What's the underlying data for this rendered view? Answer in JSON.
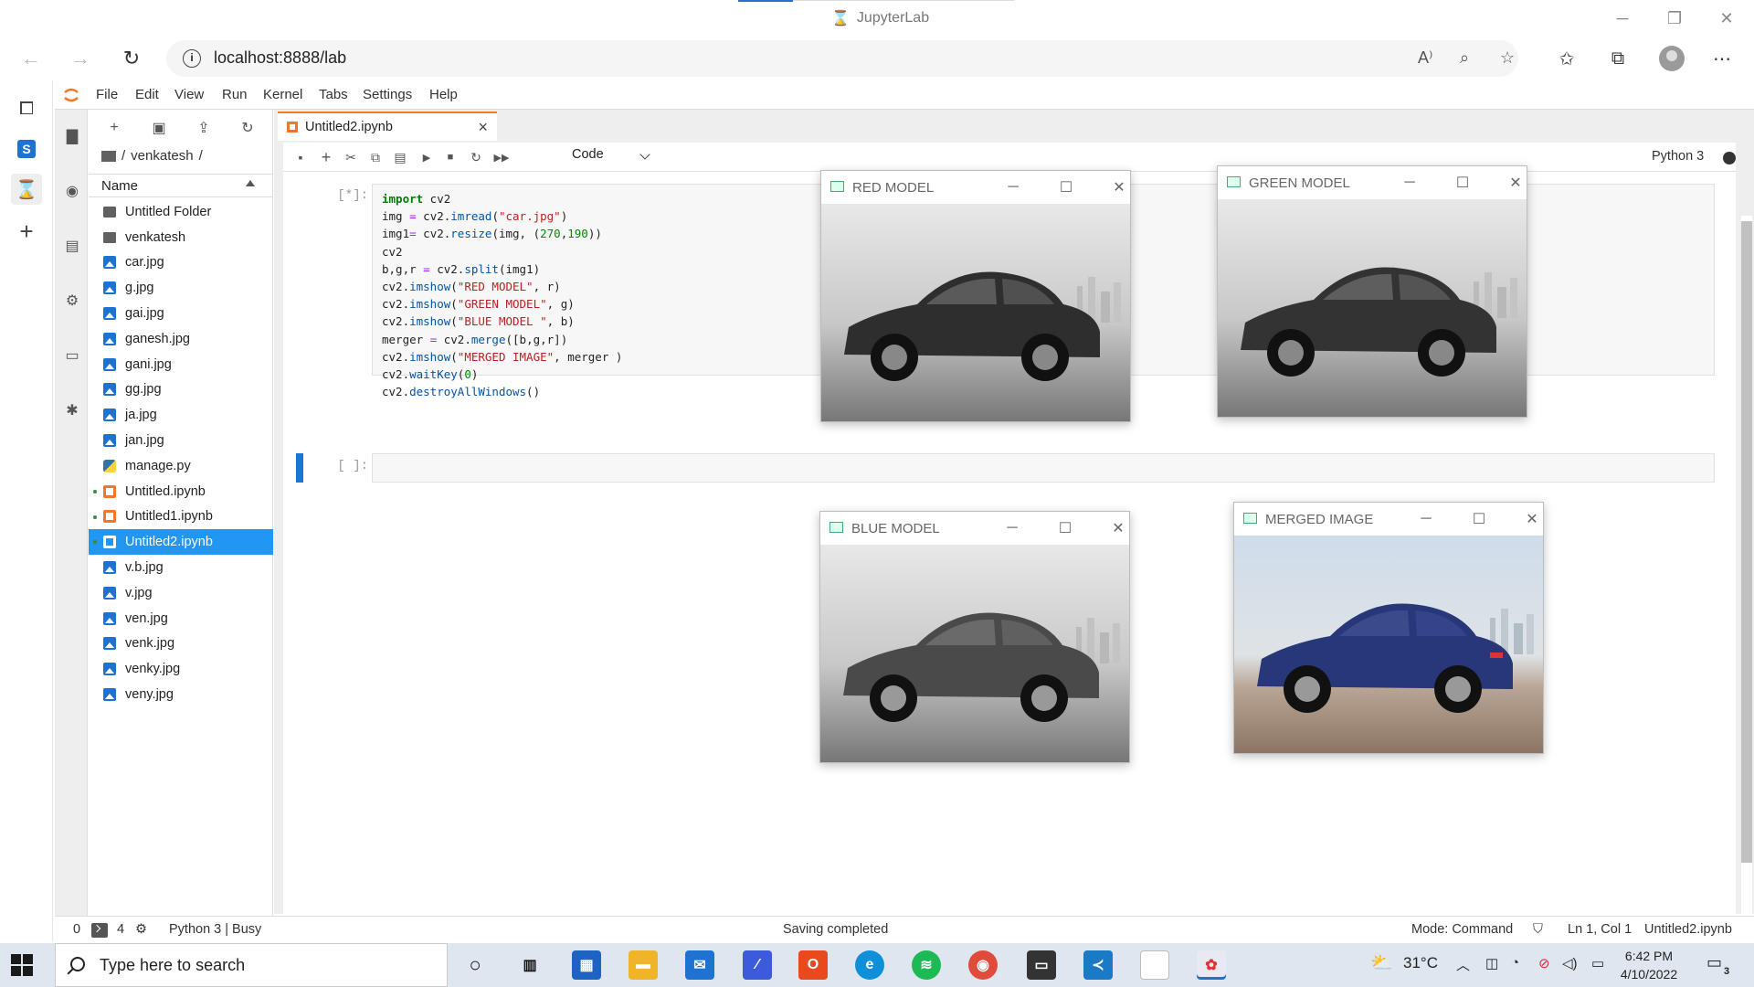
{
  "browser": {
    "window_title": "JupyterLab",
    "url": "localhost:8888/lab"
  },
  "jupyter": {
    "menu": [
      "File",
      "Edit",
      "View",
      "Run",
      "Kernel",
      "Tabs",
      "Settings",
      "Help"
    ],
    "breadcrumb": [
      "/",
      "venkatesh",
      "/"
    ],
    "file_header": "Name",
    "files": [
      {
        "name": "Untitled Folder",
        "type": "folder",
        "running": false,
        "selected": false
      },
      {
        "name": "venkatesh",
        "type": "folder",
        "running": false,
        "selected": false
      },
      {
        "name": "car.jpg",
        "type": "image",
        "running": false,
        "selected": false
      },
      {
        "name": "g.jpg",
        "type": "image",
        "running": false,
        "selected": false
      },
      {
        "name": "gai.jpg",
        "type": "image",
        "running": false,
        "selected": false
      },
      {
        "name": "ganesh.jpg",
        "type": "image",
        "running": false,
        "selected": false
      },
      {
        "name": "gani.jpg",
        "type": "image",
        "running": false,
        "selected": false
      },
      {
        "name": "gg.jpg",
        "type": "image",
        "running": false,
        "selected": false
      },
      {
        "name": "ja.jpg",
        "type": "image",
        "running": false,
        "selected": false
      },
      {
        "name": "jan.jpg",
        "type": "image",
        "running": false,
        "selected": false
      },
      {
        "name": "manage.py",
        "type": "python",
        "running": false,
        "selected": false
      },
      {
        "name": "Untitled.ipynb",
        "type": "notebook",
        "running": true,
        "selected": false
      },
      {
        "name": "Untitled1.ipynb",
        "type": "notebook",
        "running": true,
        "selected": false
      },
      {
        "name": "Untitled2.ipynb",
        "type": "notebook",
        "running": true,
        "selected": true
      },
      {
        "name": "v.b.jpg",
        "type": "image",
        "running": false,
        "selected": false
      },
      {
        "name": "v.jpg",
        "type": "image",
        "running": false,
        "selected": false
      },
      {
        "name": "ven.jpg",
        "type": "image",
        "running": false,
        "selected": false
      },
      {
        "name": "venk.jpg",
        "type": "image",
        "running": false,
        "selected": false
      },
      {
        "name": "venky.jpg",
        "type": "image",
        "running": false,
        "selected": false
      },
      {
        "name": "veny.jpg",
        "type": "image",
        "running": false,
        "selected": false
      }
    ],
    "tab_title": "Untitled2.ipynb",
    "cell_type": "Code",
    "kernel_name": "Python 3",
    "cells": [
      {
        "prompt": "[*]:",
        "code": "import cv2\nimg = cv2.imread(\"car.jpg\")\nimg1= cv2.resize(img, (270,190))\ncv2\nb,g,r = cv2.split(img1)\ncv2.imshow(\"RED MODEL\", r)\ncv2.imshow(\"GREEN MODEL\", g)\ncv2.imshow(\"BLUE MODEL \", b)\nmerger = cv2.merge([b,g,r])\ncv2.imshow(\"MERGED IMAGE\", merger )\ncv2.waitKey(0)\ncv2.destroyAllWindows()"
      },
      {
        "prompt": "[ ]:",
        "code": ""
      }
    ]
  },
  "cv_windows": [
    {
      "title": "RED MODEL",
      "tint": "gray"
    },
    {
      "title": "GREEN MODEL",
      "tint": "gray"
    },
    {
      "title": "BLUE MODEL",
      "tint": "gray"
    },
    {
      "title": "MERGED IMAGE",
      "tint": "color"
    }
  ],
  "status": {
    "terminals": "0",
    "kernels": "4",
    "kernel_status": "Python 3 | Busy",
    "message": "Saving completed",
    "mode": "Mode: Command",
    "cursor": "Ln 1, Col 1",
    "file": "Untitled2.ipynb"
  },
  "taskbar": {
    "search_placeholder": "Type here to search",
    "weather": "31°C",
    "time": "6:42 PM",
    "date": "4/10/2022",
    "notifications": "3"
  },
  "colors": {
    "jupyter_orange": "#f37726",
    "selection_blue": "#2196f3",
    "active_cell": "#1976d2"
  }
}
